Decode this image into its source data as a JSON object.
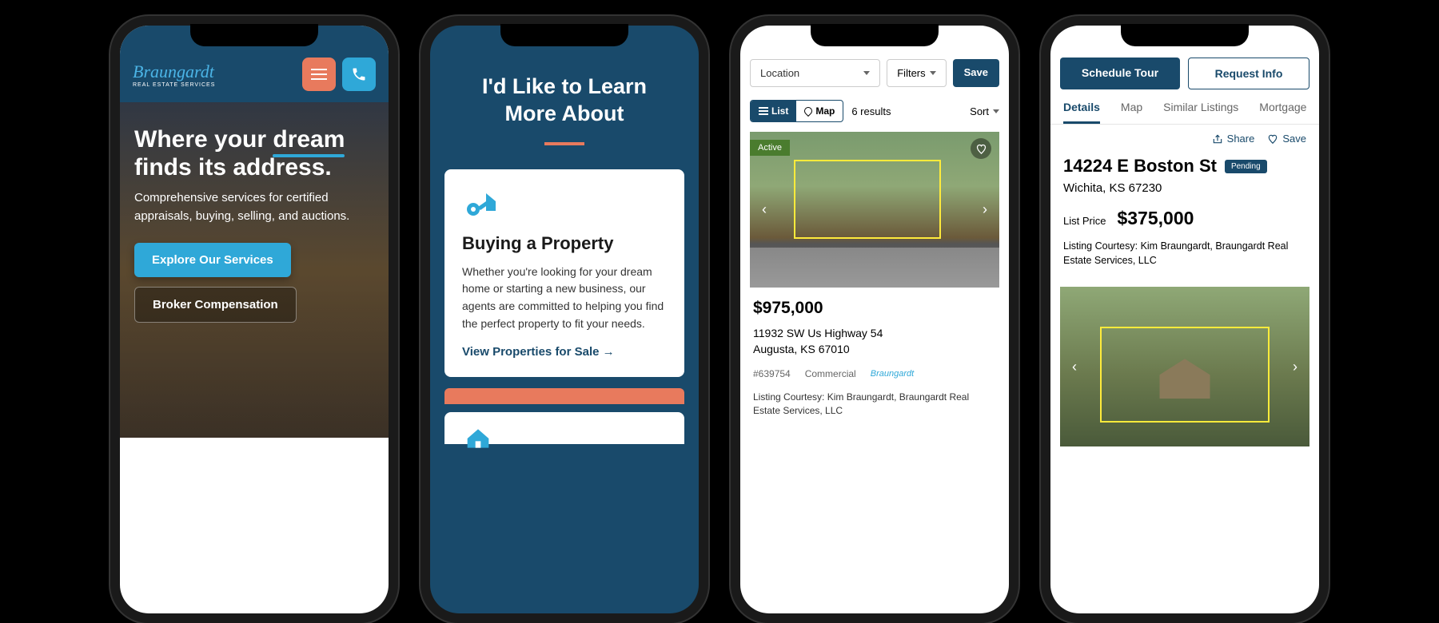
{
  "phone1": {
    "brand": "Braungardt",
    "brand_sub": "REAL ESTATE SERVICES",
    "hero_title_pre": "Where your ",
    "hero_title_dream": "dream",
    "hero_title_post": " finds its address.",
    "hero_sub": "Comprehensive services for certified appraisals, buying, selling, and auctions.",
    "cta_primary": "Explore Our Services",
    "cta_secondary": "Broker Compensation"
  },
  "phone2": {
    "title_line1": "I'd Like to Learn",
    "title_line2": "More About",
    "card_title": "Buying a Property",
    "card_text": "Whether you're looking for your dream home or starting a new business, our agents are committed to helping you find the perfect property to fit your needs.",
    "card_link": "View Properties for Sale"
  },
  "phone3": {
    "location_placeholder": "Location",
    "filters_label": "Filters",
    "save_label": "Save",
    "list_label": "List",
    "map_label": "Map",
    "results_count": "6 results",
    "sort_label": "Sort",
    "badge": "Active",
    "price": "$975,000",
    "address_line1": "11932 SW Us Highway 54",
    "address_line2": "Augusta, KS 67010",
    "mls": "#639754",
    "type": "Commercial",
    "courtesy": "Listing Courtesy: Kim Braungardt, Braungardt Real Estate Services, LLC"
  },
  "phone4": {
    "schedule": "Schedule Tour",
    "request": "Request Info",
    "tabs": {
      "details": "Details",
      "map": "Map",
      "similar": "Similar Listings",
      "mortgage": "Mortgage"
    },
    "share": "Share",
    "save": "Save",
    "address": "14224 E Boston St",
    "status": "Pending",
    "city": "Wichita, KS 67230",
    "list_price_label": "List Price",
    "price": "$375,000",
    "courtesy": "Listing Courtesy: Kim Braungardt, Braungardt Real Estate Services, LLC"
  }
}
